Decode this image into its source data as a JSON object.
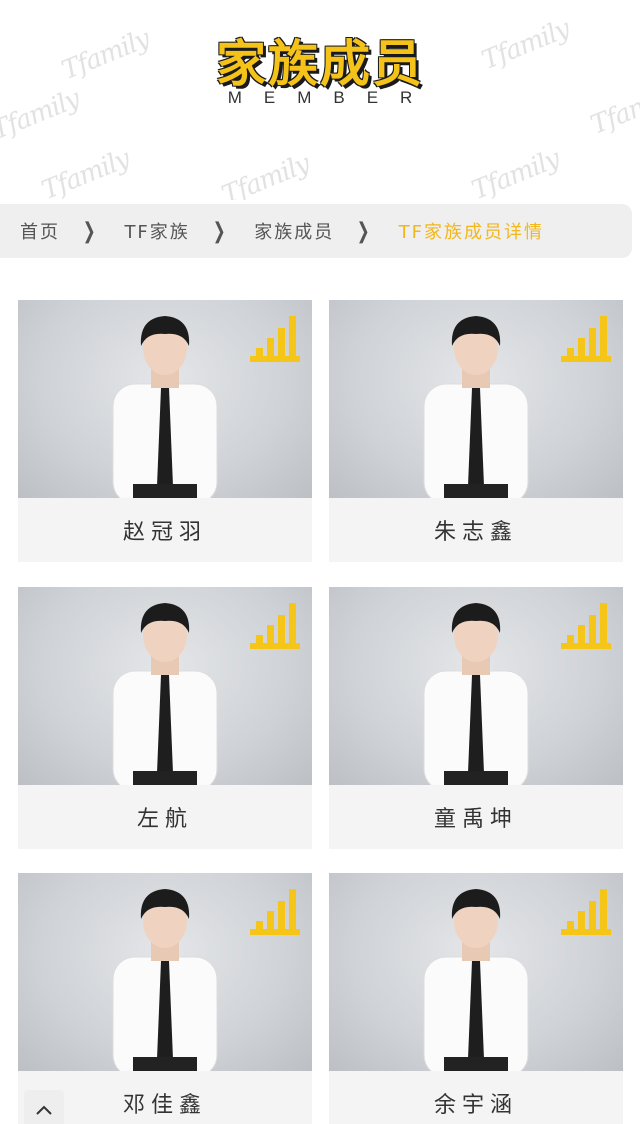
{
  "header": {
    "title": "家族成员",
    "subtitle": "MEMBER"
  },
  "breadcrumb": {
    "items": [
      "首页",
      "TF家族",
      "家族成员",
      "TF家族成员详情"
    ],
    "active_color": "#f2b71c"
  },
  "members": [
    {
      "name": "赵冠羽",
      "icon": "signal-bars-icon"
    },
    {
      "name": "朱志鑫",
      "icon": "signal-bars-icon"
    },
    {
      "name": "左航",
      "icon": "signal-bars-icon"
    },
    {
      "name": "童禹坤",
      "icon": "signal-bars-icon"
    },
    {
      "name": "邓佳鑫",
      "icon": "signal-bars-icon"
    },
    {
      "name": "余宇涵",
      "icon": "signal-bars-icon"
    }
  ],
  "colors": {
    "accent": "#f5c518",
    "card_bg": "#f4f4f4",
    "breadcrumb_bg": "#efefef"
  },
  "back_to_top_icon": "chevron-up-icon"
}
